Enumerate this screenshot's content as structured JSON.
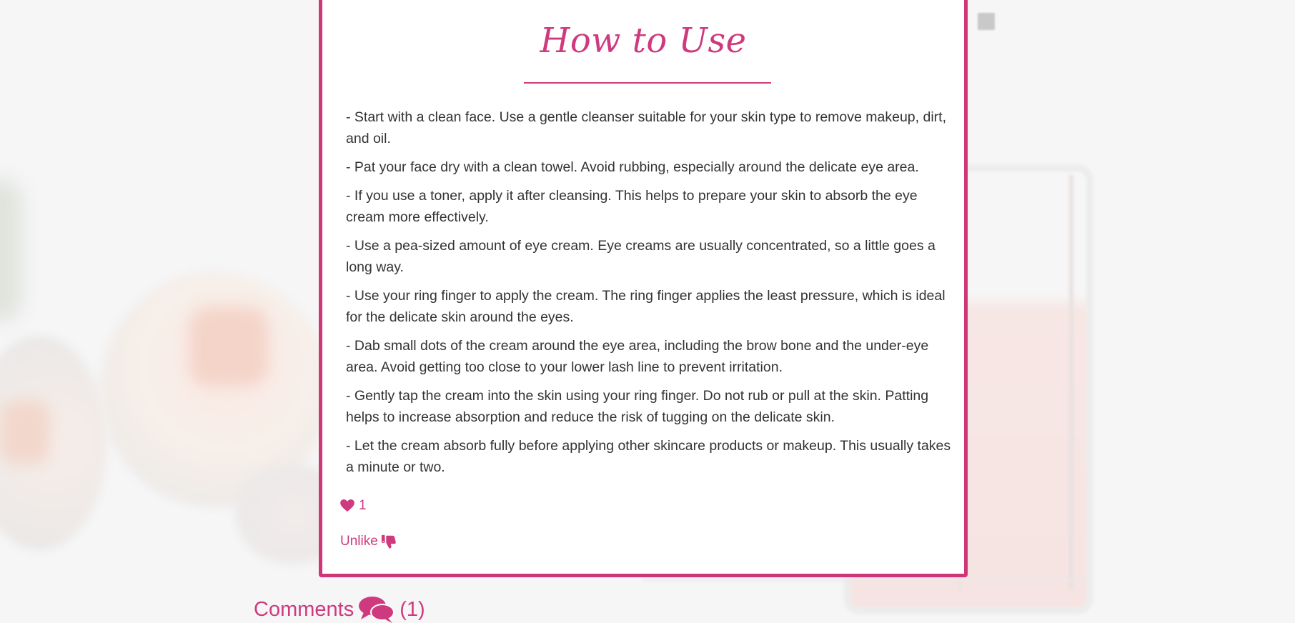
{
  "section": {
    "title": "How to Use",
    "steps": [
      "- Start with a clean face. Use a gentle cleanser suitable for your skin type to remove makeup, dirt, and oil.",
      "- Pat your face dry with a clean towel. Avoid rubbing, especially around the delicate eye area.",
      "- If you use a toner, apply it after cleansing. This helps to prepare your skin to absorb the eye cream more effectively.",
      "- Use a pea-sized amount of eye cream. Eye creams are usually concentrated, so a little goes a long way.",
      "- Use your ring finger to apply the cream. The ring finger applies the least pressure, which is ideal for the delicate skin around the eyes.",
      "- Dab small dots of the cream around the eye area, including the brow bone and the under-eye area. Avoid getting too close to your lower lash line to prevent irritation.",
      "- Gently tap the cream into the skin using your ring finger. Do not rub or pull at the skin. Patting helps to increase absorption and reduce the risk of tugging on the delicate skin.",
      "- Let the cream absorb fully before applying other skincare products or makeup. This usually takes a minute or two."
    ]
  },
  "likes": {
    "count": "1",
    "icon": "heart-icon"
  },
  "unlike": {
    "label": "Unlike",
    "icon": "thumbs-down-icon"
  },
  "comments": {
    "label": "Comments",
    "count": "(1)",
    "icon": "comments-icon"
  },
  "colors": {
    "accent": "#cf3a7e",
    "text": "#333333",
    "card_bg": "#ffffff"
  }
}
